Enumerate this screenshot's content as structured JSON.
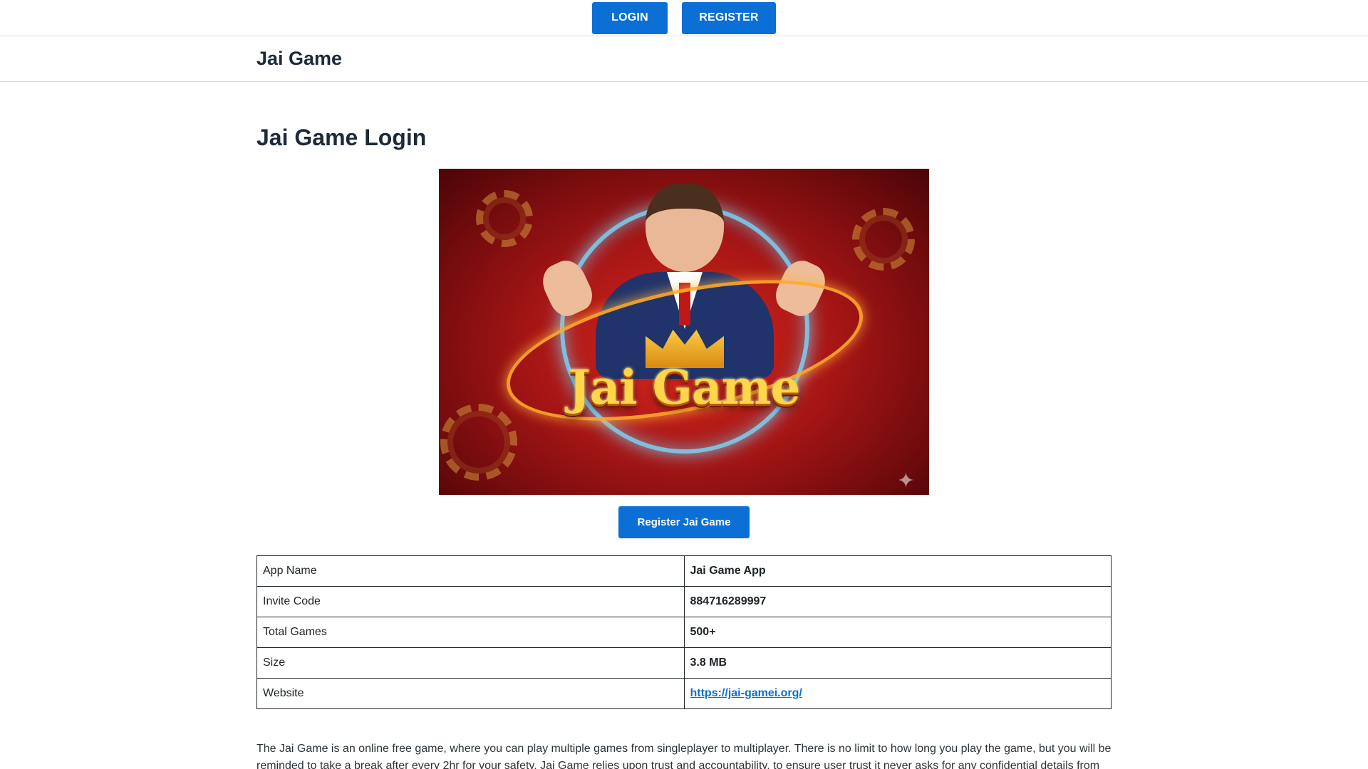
{
  "topbar": {
    "login_label": "LOGIN",
    "register_label": "REGISTER"
  },
  "header": {
    "site_title": "Jai Game"
  },
  "main": {
    "page_title": "Jai Game Login",
    "hero_logo_text": "Jai Game",
    "cta_label": "Register Jai Game",
    "info_table": [
      {
        "label": "App Name",
        "value": "Jai Game App"
      },
      {
        "label": "Invite Code",
        "value": "884716289997"
      },
      {
        "label": "Total Games",
        "value": "500+"
      },
      {
        "label": "Size",
        "value": "3.8 MB"
      },
      {
        "label": "Website",
        "value": "https://jai-gamei.org/"
      }
    ],
    "intro_paragraph": "The Jai Game is an online free game, where you can play multiple games from singleplayer to multiplayer. There is no limit to how long you play the game, but you will be reminded to take a break after every 2hr for your safety. Jai Game relies upon trust and accountability, to ensure user trust it never asks for any confidential details from"
  },
  "colors": {
    "button_blue": "#0b6fd6",
    "heading": "#1d2a3a",
    "border": "#dcdcde"
  }
}
